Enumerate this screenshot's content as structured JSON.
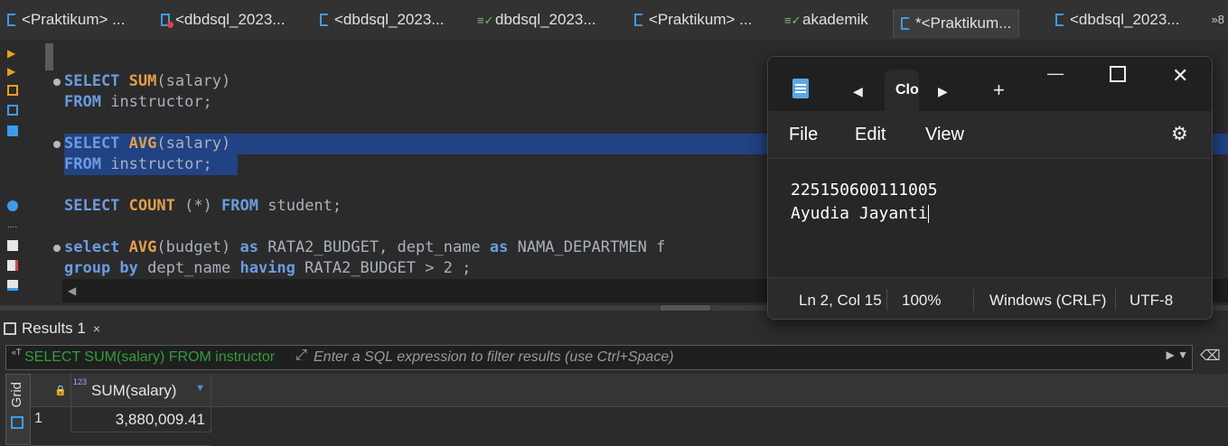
{
  "tabs": [
    {
      "label": "<Praktikum> ...",
      "icon": "sql-script-icon"
    },
    {
      "label": "<dbdsql_2023...",
      "icon": "sql-script-error-icon"
    },
    {
      "label": "<dbdsql_2023...",
      "icon": "sql-script-icon"
    },
    {
      "label": "dbdsql_2023...",
      "icon": "sql-console-icon"
    },
    {
      "label": "<Praktikum> ...",
      "icon": "sql-script-icon"
    },
    {
      "label": "akademik",
      "icon": "sql-console-icon"
    },
    {
      "label": "*<Praktikum...",
      "icon": "sql-script-active-icon"
    },
    {
      "label": "<dbdsql_2023...",
      "icon": "sql-script-icon"
    }
  ],
  "tab_overflow": "»8",
  "editor": {
    "lines": [
      {
        "kw1": "SELECT",
        "fn": "SUM",
        "rest": "(salary)"
      },
      {
        "kw1": "FROM",
        "rest": "instructor;"
      },
      {
        "kw1": "SELECT",
        "fn": "AVG",
        "rest": "(salary)"
      },
      {
        "kw1": "FROM",
        "rest": "instructor;"
      },
      {
        "kw1": "SELECT",
        "fn": "COUNT",
        "mid": " (*) ",
        "kw2": "FROM",
        "rest": "student;"
      },
      {
        "kw1": "select",
        "fn": "AVG",
        "mid": "(budget) ",
        "kw2": "as",
        "mid2": " RATA2_BUDGET, dept_name ",
        "kw3": "as",
        "rest": " NAMA_DEPARTMEN f"
      },
      {
        "kw1": "group by",
        "mid": " dept_name ",
        "kw2": "having",
        "rest": " RATA2_BUDGET > 2 ;"
      }
    ]
  },
  "results": {
    "tab_label": "Results 1",
    "close": "×",
    "filter_query": "SELECT SUM(salary) FROM instructor",
    "filter_placeholder": "Enter a SQL expression to filter results (use Ctrl+Space)",
    "side_label": "Grid",
    "column_type": "123",
    "column_name": "SUM(salary)",
    "rows": [
      {
        "num": "1",
        "value": "3,880,009.41"
      }
    ]
  },
  "notepad": {
    "tab_label": "Clo",
    "menu": [
      "File",
      "Edit",
      "View"
    ],
    "content_lines": [
      "225150600111005",
      "Ayudia Jayanti"
    ],
    "status": {
      "position": "Ln 2, Col 15",
      "zoom": "100%",
      "line_ending": "Windows (CRLF)",
      "encoding": "UTF-8"
    }
  }
}
